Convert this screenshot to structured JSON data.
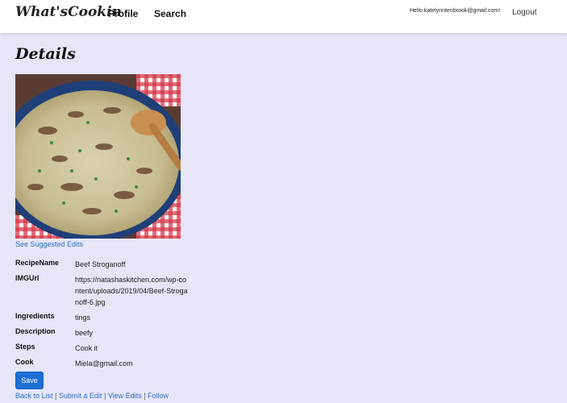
{
  "navbar": {
    "brand": "What'sCookin",
    "profile_label": "Profile",
    "search_label": "Search",
    "greeting": "Hello katelynntenbrook@gmail.com!",
    "logout_label": "Logout"
  },
  "page": {
    "title": "Details",
    "suggested_edits_label": "See Suggested Edits"
  },
  "details": {
    "recipe_name_label": "RecipeName",
    "recipe_name_value": "Beef Stroganoff",
    "img_url_label": "IMGUrl",
    "img_url_value": "https://natashaskitchen.com/wp-content/uploads/2019/04/Beef-Stroganoff-6.jpg",
    "ingredients_label": "Ingredients",
    "ingredients_value": "tings",
    "description_label": "Description",
    "description_value": "beefy",
    "steps_label": "Steps",
    "steps_value": "Cook it",
    "cook_label": "Cook",
    "cook_value": "Miela@gmail.com"
  },
  "actions": {
    "save_label": "Save",
    "back_label": "Back to List",
    "submit_edit_label": "Submit a Edit",
    "view_edits_label": "View Edits",
    "follow_label": "Follow",
    "separator": "|"
  },
  "colors": {
    "background": "#e6e6f8",
    "link": "#2e6fc6",
    "save_button": "#1d6fd6"
  }
}
